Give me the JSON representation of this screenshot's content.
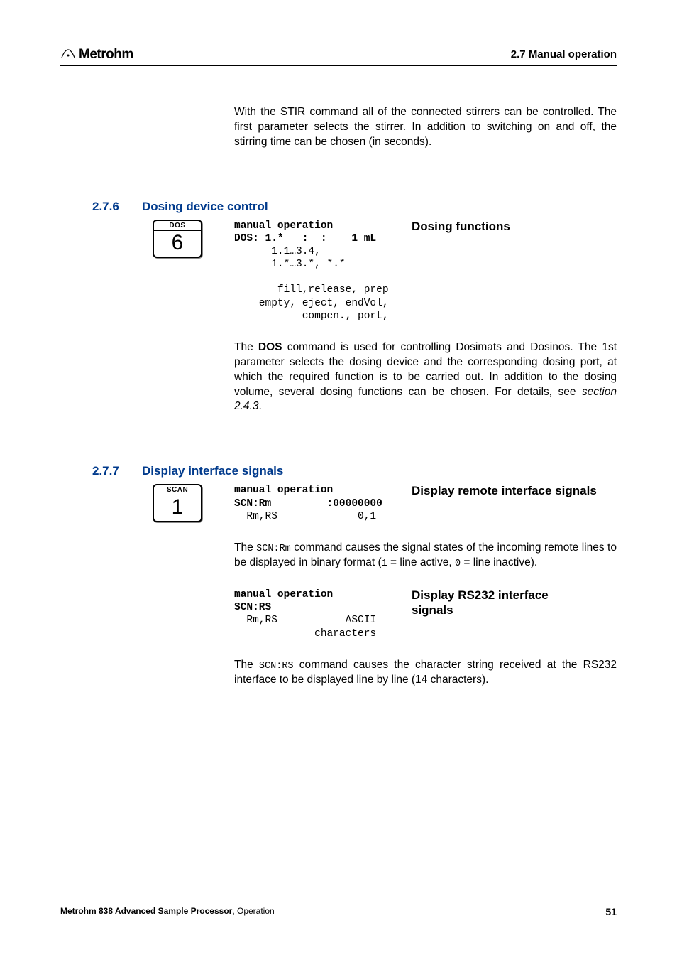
{
  "header": {
    "logo_text": "Metrohm",
    "section": "2.7 Manual operation"
  },
  "intro_paragraph": "With the STIR command all of the connected stirrers can be controlled. The first parameter selects the stirrer. In addition to switching on and off, the stirring time can be chosen (in seconds).",
  "section_276": {
    "num": "2.7.6",
    "title": "Dosing device control",
    "key_label": "DOS",
    "key_number": "6",
    "mono_line1": "manual operation",
    "mono_line2": "DOS: 1.*   :  :    1 mL",
    "mono_line3": "      1.1…3.4,",
    "mono_line4": "      1.*…3.*, *.*",
    "mono_line5": "",
    "mono_line6": "       fill,release, prep",
    "mono_line7": "    empty, eject, endVol,",
    "mono_line8": "           compen., port,",
    "info_title": "Dosing functions",
    "para_pre": "The ",
    "para_bold": "DOS",
    "para_post": " command is used for controlling Dosimats and Dosinos. The 1st parameter selects the dosing device and the corresponding dosing port, at which the required function is to be carried out. In addition to the dosing volume, several dosing functions can be chosen. For details, see ",
    "para_italic": "section 2.4.3",
    "para_end": "."
  },
  "section_277": {
    "num": "2.7.7",
    "title": "Display interface signals",
    "key_label": "SCAN",
    "key_number": "1",
    "block_a": {
      "mono_line1": "manual operation",
      "mono_line2": "SCN:Rm         :00000000",
      "mono_line3": "  Rm,RS             0,1",
      "info_title": "Display remote interface signals",
      "para_pre": "The ",
      "para_mono": "SCN:Rm",
      "para_mid": " command causes the signal states of the incoming remote lines to be displayed in binary format (",
      "para_mono2": "1",
      "para_mid2": " = line active, ",
      "para_mono3": "0",
      "para_end": " = line inactive)."
    },
    "block_b": {
      "mono_line1": "manual operation",
      "mono_line2": "SCN:RS",
      "mono_line3": "  Rm,RS           ASCII",
      "mono_line4": "             characters",
      "info_title": "Display RS232 interface signals",
      "para_pre": "The ",
      "para_mono": "SCN:RS",
      "para_end": " command causes the character string received at the RS232 interface to be displayed line by line (14 characters)."
    }
  },
  "footer": {
    "product": "Metrohm 838 Advanced Sample Processor",
    "suffix": ", Operation",
    "page": "51"
  }
}
